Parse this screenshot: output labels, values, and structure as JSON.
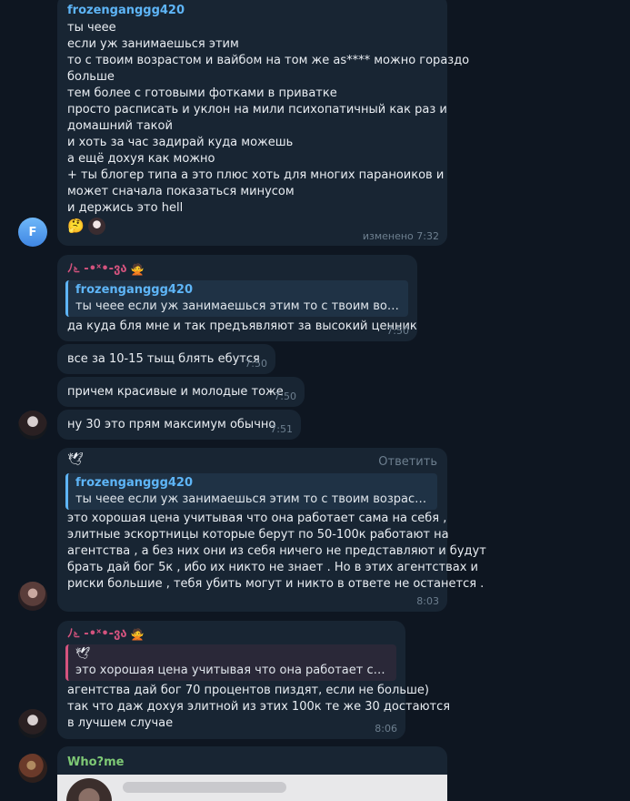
{
  "colors": {
    "background": "#0e1621",
    "bubble": "#182533",
    "accent_blue": "#5eb5f7",
    "accent_pink": "#d4537e",
    "accent_green": "#7ec975",
    "meta_text": "#6d7f8f"
  },
  "messages": {
    "m1": {
      "sender": "frozenganggg420",
      "lines": [
        "ты чеее",
        "если уж занимаешься этим",
        "то с твоим возрастом и вайбом на том же as**** можно гораздо",
        "больше",
        "тем более с готовыми фотками в приватке",
        "просто расписать и уклон на мили психопатичный как раз и",
        "домашний такой",
        "и хоть за час задирай куда можешь",
        "а ещё дохуя как можно",
        "+ ты блогер типа а это плюс хоть для многих параноиков и",
        "может сначала показаться минусом",
        "и держись это hell"
      ],
      "emoji": "🤔",
      "meta": "изменено 7:32",
      "avatar_letter": "F"
    },
    "m2": {
      "sender": "ﾉ೬ -•ˣ•-ვა",
      "sender_emoji": "🙅",
      "reply_name": "frozenganggg420",
      "reply_text": "ты чеее  если уж занимаешься этим  то с твоим возраст...",
      "text": "да куда бля мне и так предъявляют за высокий ценник",
      "time": "7:50"
    },
    "m3": {
      "text": "все за 10-15 тыщ блять ебутся",
      "time": "7:50"
    },
    "m4": {
      "text": "причем красивые и молодые тоже",
      "time": "7:50"
    },
    "m5": {
      "text": "ну 30 это прям максимум обычно",
      "time": "7:51"
    },
    "m6": {
      "sender_icon": "🕊",
      "reply_action": "Ответить",
      "reply_name": "frozenganggg420",
      "reply_text": "ты чеее  если уж занимаешься этим  то с твоим возрастом и ...",
      "lines": [
        "это хорошая цена учитывая что она работает сама на себя ,",
        "элитные эскортницы которые берут по 50-100к работают на",
        "агентства , а без них они из себя ничего не представляют и будут",
        "брать дай бог 5к , ибо их никто не знает . Но в этих агентствах и",
        "риски большие , тебя убить могут и никто в ответе не останется ."
      ],
      "time": "8:03"
    },
    "m7": {
      "sender": "ﾉ೬ -•ˣ•-ვა",
      "sender_emoji": "🙅",
      "reply_icon": "🕊",
      "reply_text": "это хорошая цена учитывая что она работает сама на...",
      "lines": [
        "агентства дай бог 70 процентов пиздят, если не больше)",
        "так что даж дохуя элитной из этих 100к те же 30 достаются",
        "в лучшем случае"
      ],
      "time": "8:06"
    },
    "m8": {
      "sender": "Who?me"
    }
  }
}
